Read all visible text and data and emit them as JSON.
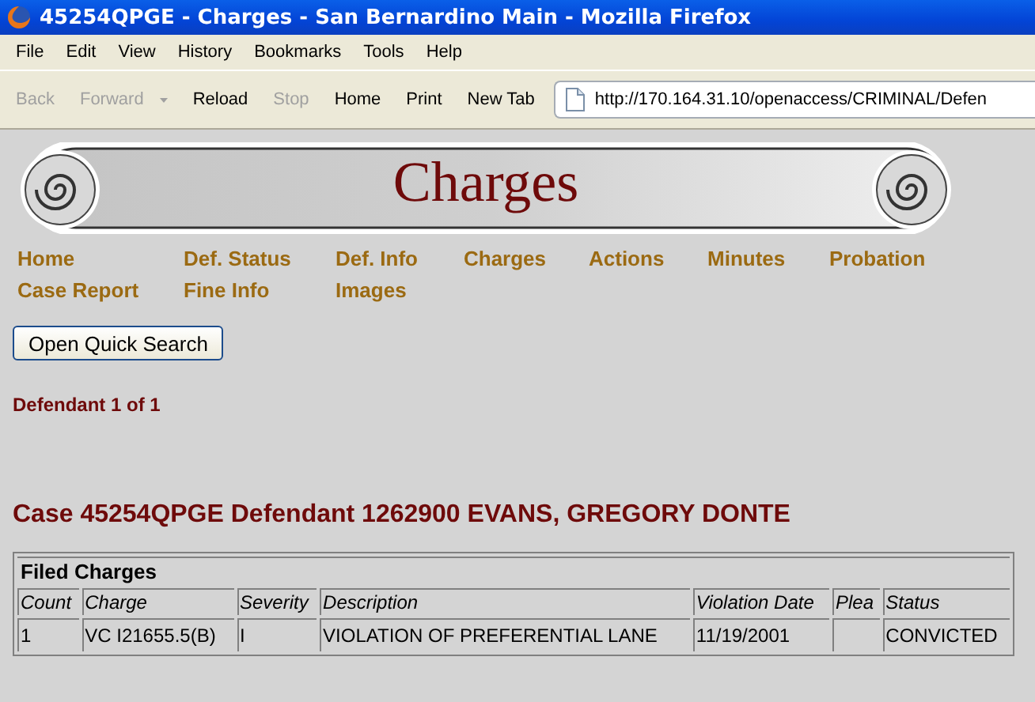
{
  "window": {
    "title": "45254QPGE - Charges - San Bernardino Main - Mozilla Firefox"
  },
  "menu": [
    "File",
    "Edit",
    "View",
    "History",
    "Bookmarks",
    "Tools",
    "Help"
  ],
  "toolbar": [
    {
      "label": "Back",
      "disabled": true
    },
    {
      "label": "Forward",
      "disabled": true,
      "kind": "dropdown"
    },
    {
      "label": "Reload",
      "disabled": false
    },
    {
      "label": "Stop",
      "disabled": true
    },
    {
      "label": "Home",
      "disabled": false
    },
    {
      "label": "Print",
      "disabled": false
    },
    {
      "label": "New Tab",
      "disabled": false
    }
  ],
  "address": "http://170.164.31.10/openaccess/CRIMINAL/Defen",
  "banner": {
    "title": "Charges"
  },
  "nav": [
    [
      "Home",
      "Def. Status",
      "Def. Info",
      "Charges",
      "Actions",
      "Minutes",
      "Probation"
    ],
    [
      "Case Report",
      "Fine Info",
      "Images"
    ]
  ],
  "quick_search_button": "Open Quick Search",
  "defendant_counter": "Defendant 1 of 1",
  "case_heading": "Case 45254QPGE Defendant 1262900 EVANS, GREGORY DONTE",
  "table": {
    "title": "Filed Charges",
    "columns": [
      "Count",
      "Charge",
      "Severity",
      "Description",
      "Violation Date",
      "Plea",
      "Status"
    ],
    "rows": [
      [
        "1",
        "VC I21655.5(B)",
        "I",
        "VIOLATION OF PREFERENTIAL LANE",
        "11/19/2001",
        "",
        "CONVICTED"
      ]
    ]
  }
}
